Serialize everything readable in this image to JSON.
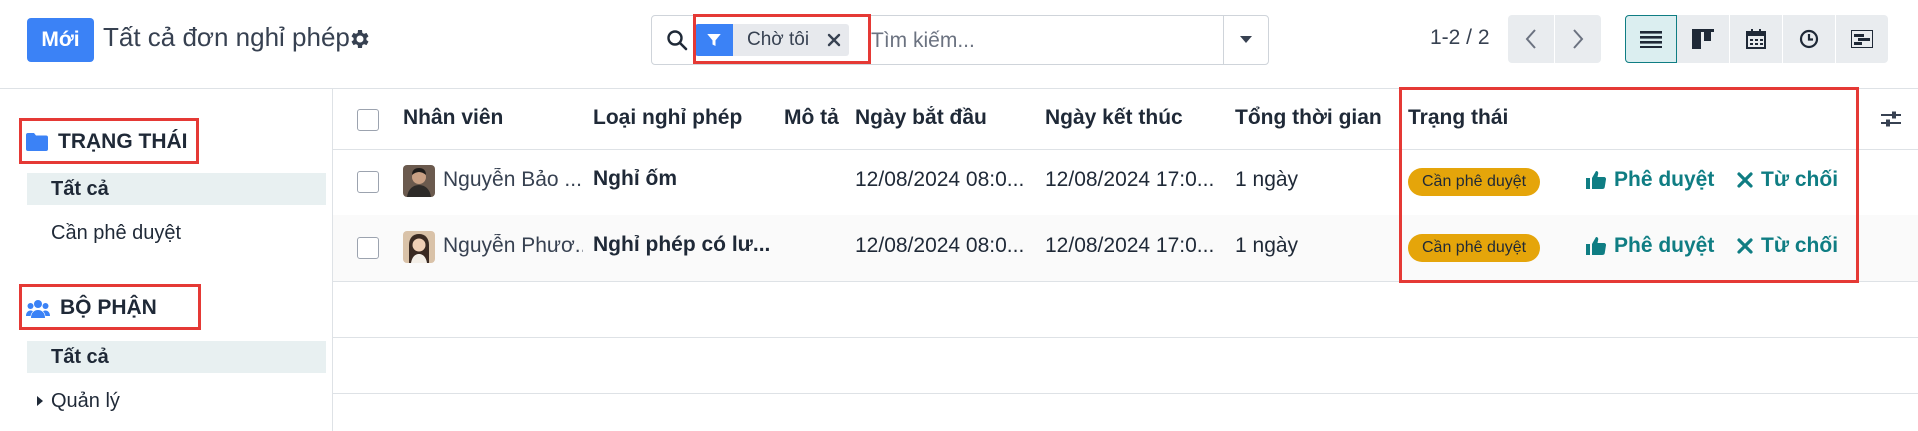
{
  "toolbar": {
    "new_label": "Mới",
    "title": "Tất cả đơn nghỉ phép",
    "search_facet": "Chờ tôi",
    "search_placeholder": "Tìm kiếm...",
    "pager": "1-2 / 2"
  },
  "sidebar": {
    "status_header": "TRẠNG THÁI",
    "status_items": [
      "Tất cả",
      "Cần phê duyệt"
    ],
    "department_header": "BỘ PHẬN",
    "department_items": [
      "Tất cả",
      "Quản lý"
    ]
  },
  "table": {
    "columns": [
      "Nhân viên",
      "Loại nghỉ phép",
      "Mô tả",
      "Ngày bắt đầu",
      "Ngày kết thúc",
      "Tổng thời gian",
      "Trạng thái"
    ],
    "rows": [
      {
        "employee": "Nguyễn Bảo ...",
        "leave_type": "Nghỉ ốm",
        "description": "",
        "start": "12/08/2024 08:0...",
        "end": "12/08/2024 17:0...",
        "duration": "1 ngày",
        "status": "Cần phê duyệt",
        "approve": "Phê duyệt",
        "refuse": "Từ chối"
      },
      {
        "employee": "Nguyễn Phươ...",
        "leave_type": "Nghỉ phép có lư...",
        "description": "",
        "start": "12/08/2024 08:0...",
        "end": "12/08/2024 17:0...",
        "duration": "1 ngày",
        "status": "Cần phê duyệt",
        "approve": "Phê duyệt",
        "refuse": "Từ chối"
      }
    ]
  },
  "colors": {
    "primary": "#3b82f6",
    "accent": "#0f7d83",
    "badge": "#e5a50a",
    "highlight": "#e53935"
  }
}
